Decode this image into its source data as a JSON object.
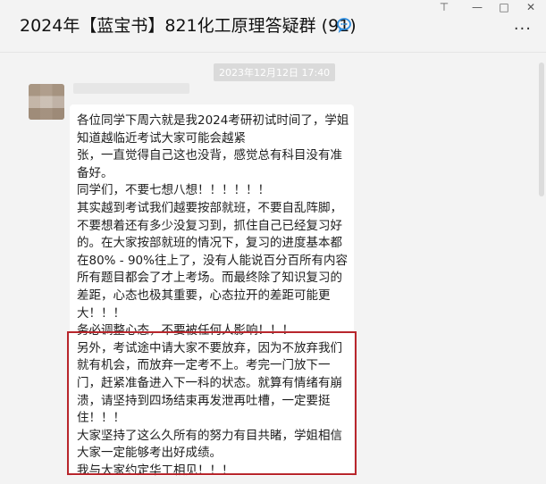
{
  "window": {
    "title": "2024年【蓝宝书】821化工原理答疑群 (91)",
    "controls": {
      "pin": "⊤",
      "minimize": "—",
      "maximize": "□",
      "close": "✕"
    },
    "more": "···"
  },
  "chat": {
    "timestamp": "2023年12月12日 17:40",
    "message": {
      "lines": [
        "各位同学下周六就是我2024考研初试时间了，学姐知道越临近考试大家可能会越紧",
        "张，一直觉得自己这也没背，感觉总有科目没有准备好。",
        "同学们，不要七想八想！！！！！！",
        "其实越到考试我们越要按部就班，不要自乱阵脚，不要想着还有多少没复习到，抓住自己已经复习好的。在大家按部就班的情况下，复习的进度基本都在80% - 90%往上了，没有人能说百分百所有内容所有题目都会了才上考场。而最终除了知识复习的差距，心态也极其重要，心态拉开的差距可能更大！！！",
        "务必调整心态，不要被任何人影响！！！",
        "另外，考试途中请大家不要放弃，因为不放弃我们就有机会，而放弃一定考不上。考完一门放下一门，赶紧准备进入下一科的状态。就算有情绪有崩溃，请坚持到四场结束再发泄再吐槽，一定要挺住！！！",
        "大家坚持了这么久所有的努力有目共睹，学姐相信大家一定能够考出好成绩。",
        "我与大家约定华工相见！！！"
      ]
    }
  },
  "colors": {
    "highlight_border": "#b8262c",
    "background": "#f3f3f3",
    "bubble": "#ffffff"
  }
}
